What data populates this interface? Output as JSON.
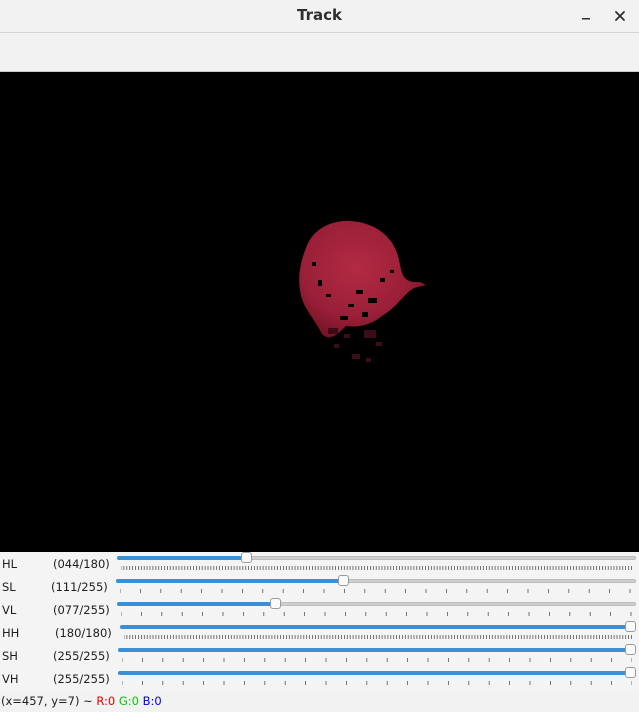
{
  "window": {
    "title": "Track",
    "minimize_icon": "minimize-icon",
    "close_icon": "close-icon"
  },
  "trackbars": [
    {
      "name": "HL",
      "display": "(044/180)",
      "value": 44,
      "max": 180
    },
    {
      "name": "SL",
      "display": "(111/255)",
      "value": 111,
      "max": 255
    },
    {
      "name": "VL",
      "display": "(077/255)",
      "value": 77,
      "max": 255
    },
    {
      "name": "HH",
      "display": "(180/180)",
      "value": 180,
      "max": 180
    },
    {
      "name": "SH",
      "display": "(255/255)",
      "value": 255,
      "max": 255
    },
    {
      "name": "VH",
      "display": "(255/255)",
      "value": 255,
      "max": 255
    }
  ],
  "status": {
    "coords": "(x=457, y=7) ~",
    "r": "R:0",
    "g": "G:0",
    "b": "B:0"
  },
  "colors": {
    "accent": "#3a8fd6",
    "r_label": "#e00000",
    "g_label": "#00c800",
    "b_label": "#0000e0",
    "ball": "#a3213b"
  }
}
